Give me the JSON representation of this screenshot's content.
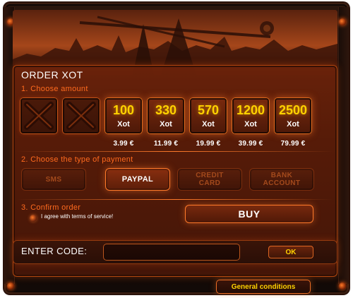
{
  "dialog": {
    "title": "ORDER XOT"
  },
  "steps": {
    "choose_amount": "1. Choose amount",
    "choose_payment": "2. Choose the type of payment",
    "confirm_order": "3. Confirm order"
  },
  "amount_tiles": [
    {
      "amount": "",
      "currency": "",
      "price": ""
    },
    {
      "amount": "",
      "currency": "",
      "price": ""
    },
    {
      "amount": "100",
      "currency": "Xot",
      "price": "3.99 €"
    },
    {
      "amount": "330",
      "currency": "Xot",
      "price": "11.99 €"
    },
    {
      "amount": "570",
      "currency": "Xot",
      "price": "19.99 €"
    },
    {
      "amount": "1200",
      "currency": "Xot",
      "price": "39.99 €"
    },
    {
      "amount": "2500",
      "currency": "Xot",
      "price": "79.99 €"
    }
  ],
  "payment_methods": [
    {
      "label": "SMS",
      "state": "disabled"
    },
    {
      "label": "PAYPAL",
      "state": "selected"
    },
    {
      "label": "CREDIT\nCARD",
      "state": "disabled"
    },
    {
      "label": "BANK\nACCOUNT",
      "state": "disabled"
    }
  ],
  "confirm": {
    "terms_label": "I agree with terms of service!",
    "buy_label": "BUY"
  },
  "code_entry": {
    "label": "ENTER CODE:",
    "input_value": "",
    "ok_label": "OK"
  },
  "footer": {
    "general_conditions_label": "General conditions"
  },
  "colors": {
    "accent_orange": "#ff7a2a",
    "gold": "#ffd200",
    "step_text": "#ff6a1e"
  },
  "icons": {
    "empty_tile": "x-slot-icon",
    "radio": "radio-button-icon"
  }
}
